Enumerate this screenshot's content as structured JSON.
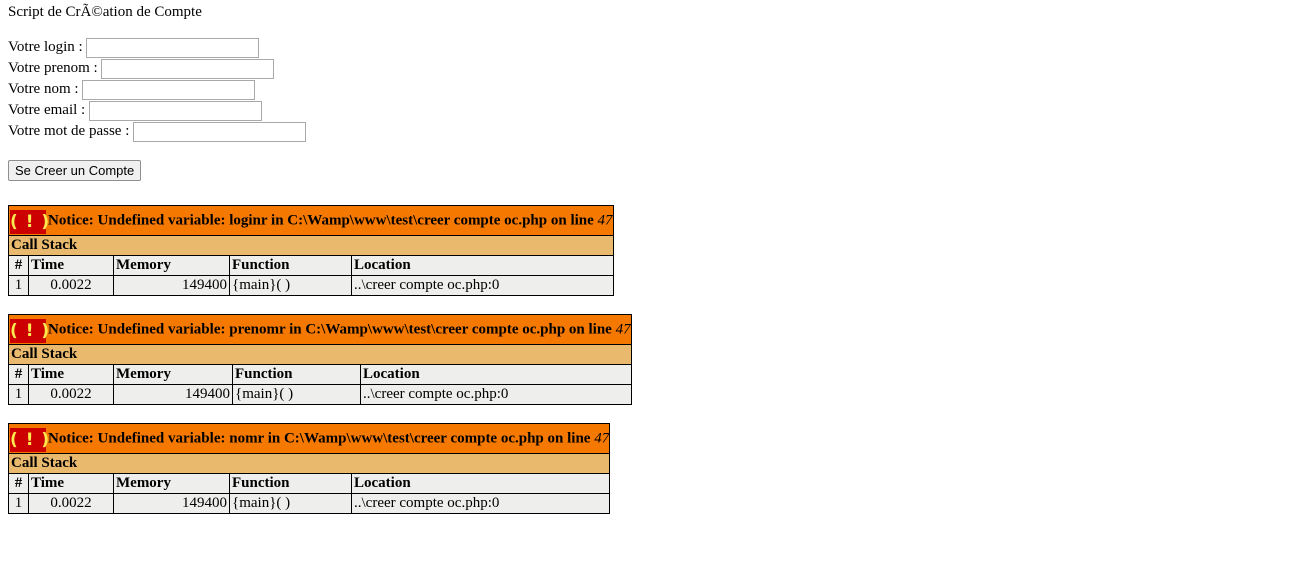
{
  "form": {
    "title": "Script de CrÃ©ation de Compte",
    "fields": [
      {
        "label": "Votre login :",
        "value": ""
      },
      {
        "label": "Votre prenom :",
        "value": ""
      },
      {
        "label": "Votre nom :",
        "value": ""
      },
      {
        "label": "Votre email :",
        "value": ""
      },
      {
        "label": "Votre mot de passe :",
        "value": ""
      }
    ],
    "submit_label": "Se Creer un Compte"
  },
  "notices": [
    {
      "icon": "( ! )",
      "message": "Notice: Undefined variable: loginr in C:\\Wamp\\www\\test\\creer compte oc.php on line ",
      "line": "47",
      "callstack_title": "Call Stack",
      "headers": [
        "#",
        "Time",
        "Memory",
        "Function",
        "Location"
      ],
      "rows": [
        [
          "1",
          "0.0022",
          "149400",
          "{main}( )",
          "..\\creer compte oc.php:0"
        ]
      ]
    },
    {
      "icon": "( ! )",
      "message": "Notice: Undefined variable: prenomr in C:\\Wamp\\www\\test\\creer compte oc.php on line ",
      "line": "47",
      "callstack_title": "Call Stack",
      "headers": [
        "#",
        "Time",
        "Memory",
        "Function",
        "Location"
      ],
      "rows": [
        [
          "1",
          "0.0022",
          "149400",
          "{main}( )",
          "..\\creer compte oc.php:0"
        ]
      ]
    },
    {
      "icon": "( ! )",
      "message": "Notice: Undefined variable: nomr in C:\\Wamp\\www\\test\\creer compte oc.php on line ",
      "line": "47",
      "callstack_title": "Call Stack",
      "headers": [
        "#",
        "Time",
        "Memory",
        "Function",
        "Location"
      ],
      "rows": [
        [
          "1",
          "0.0022",
          "149400",
          "{main}( )",
          "..\\creer compte oc.php:0"
        ]
      ]
    }
  ]
}
